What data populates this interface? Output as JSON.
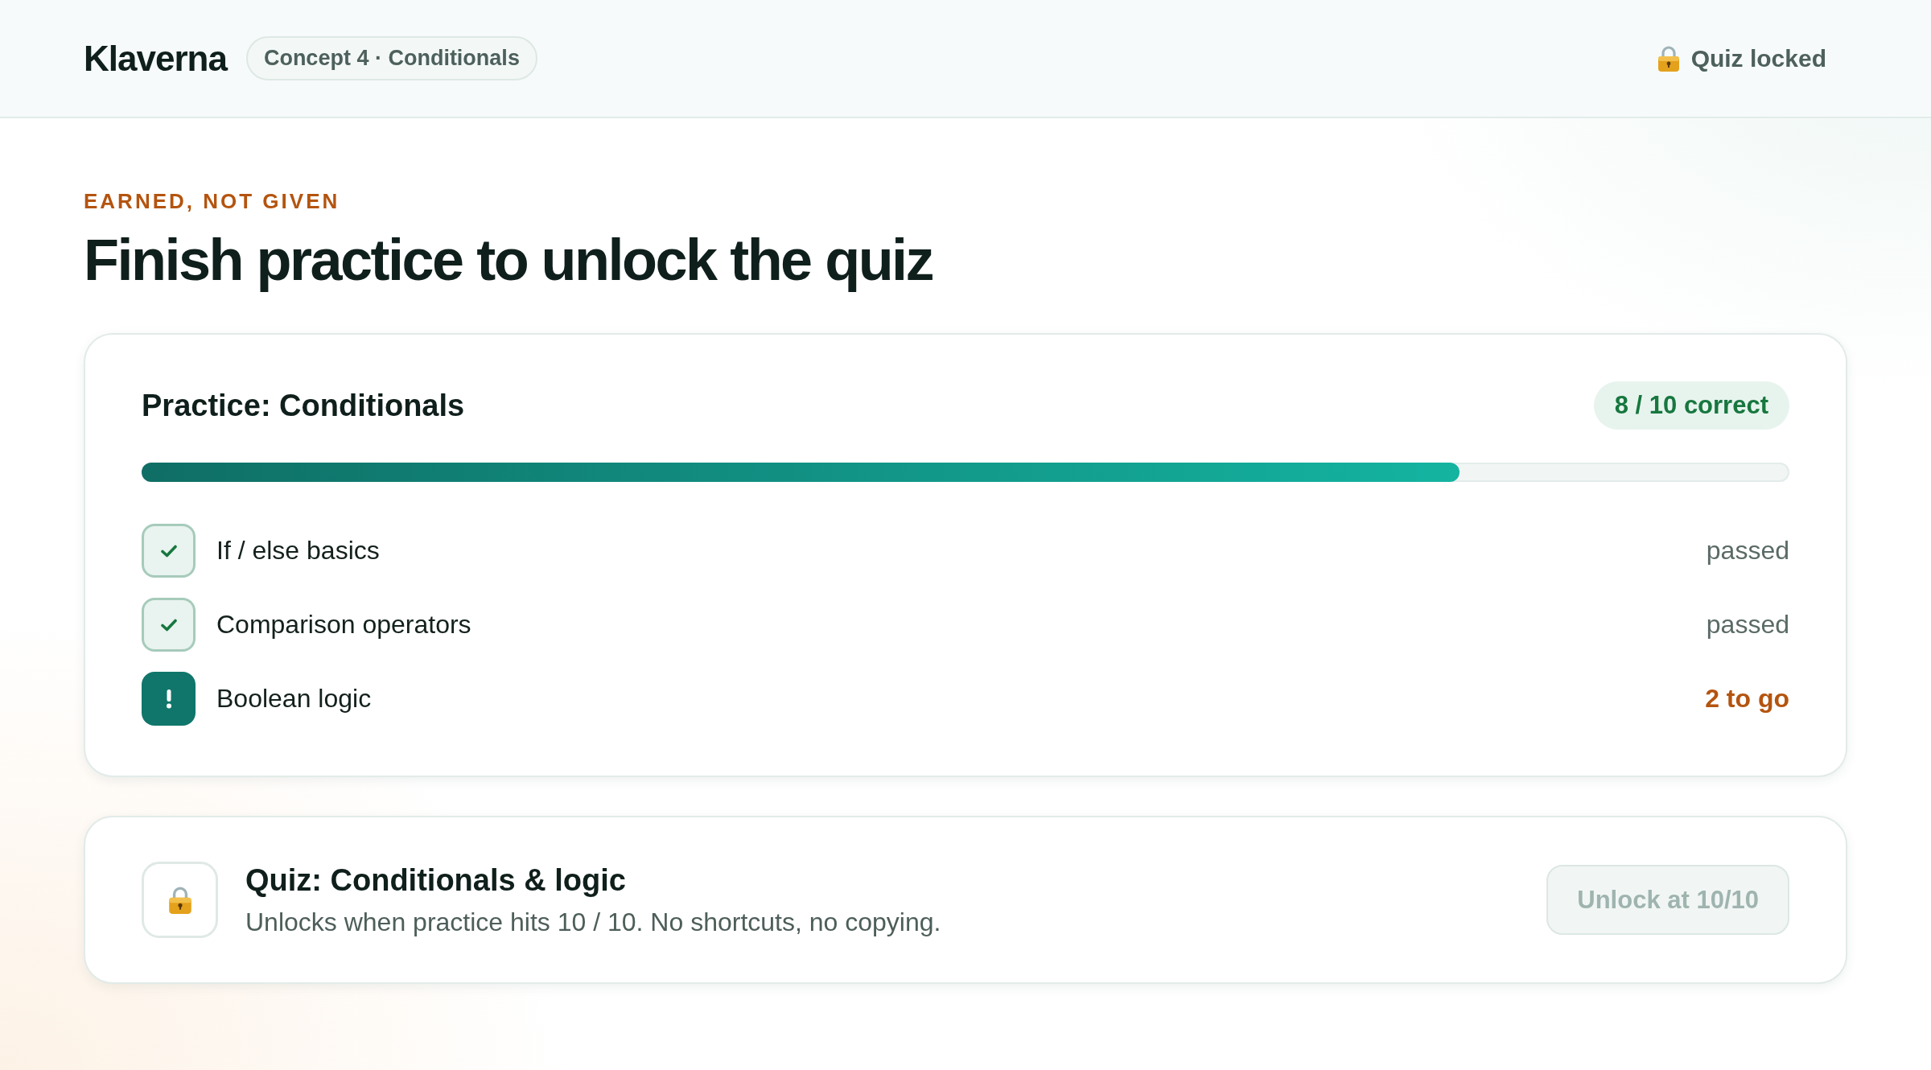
{
  "header": {
    "brand": "Klaverna",
    "chip": "Concept 4 · Conditionals",
    "status": "Quiz locked"
  },
  "intro": {
    "eyebrow": "EARNED, NOT GIVEN",
    "title": "Finish practice to unlock the quiz"
  },
  "practice": {
    "title": "Practice: Conditionals",
    "score": "8 / 10 correct",
    "level": 0.8,
    "topics": [
      {
        "label": "If / else basics",
        "status": "passed",
        "passed": true
      },
      {
        "label": "Comparison operators",
        "status": "passed",
        "passed": true
      },
      {
        "label": "Boolean logic",
        "status": "2 to go",
        "passed": false
      }
    ]
  },
  "quiz": {
    "title": "Quiz: Conditionals & logic",
    "description": "Unlocks when practice hits 10 / 10. No shortcuts, no copying.",
    "button": {
      "label": "Unlock at 10/10",
      "disabled": true
    }
  }
}
